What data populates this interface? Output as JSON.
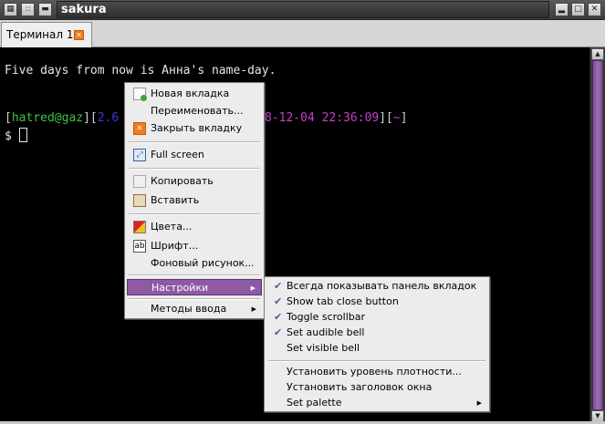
{
  "window": {
    "title": "sakura",
    "buttons": [
      "terminal-icon",
      "menu-icon",
      "minimize-icon",
      "minimize",
      "maximize",
      "close"
    ]
  },
  "tabs": [
    {
      "label": "Терминал 1",
      "close_icon": "close-x-icon"
    }
  ],
  "terminal": {
    "line1": "Five days from now is Анна's name-day.",
    "prompt": {
      "open": "[",
      "user": "hatred@gaz",
      "mid": "][",
      "version": "2.6",
      "date_tail": "8-12-04 22:36:09",
      "mid2": "][",
      "path": "~",
      "close": "]"
    },
    "ps1": "$ "
  },
  "context_menu": {
    "items": [
      {
        "label": "Новая вкладка",
        "icon": "new-tab-icon"
      },
      {
        "label": "Переименовать...",
        "icon": ""
      },
      {
        "label": "Закрыть вкладку",
        "icon": "close-tab-icon"
      },
      {
        "label": "Full screen",
        "icon": "fullscreen-icon"
      },
      {
        "label": "Копировать",
        "icon": "copy-icon"
      },
      {
        "label": "Вставить",
        "icon": "paste-icon"
      },
      {
        "label": "Цвета...",
        "icon": "colors-icon"
      },
      {
        "label": "Шрифт...",
        "icon": "font-icon"
      },
      {
        "label": "Фоновый рисунок...",
        "icon": ""
      },
      {
        "label": "Настройки",
        "submenu": true
      },
      {
        "label": "Методы ввода",
        "submenu": true
      }
    ]
  },
  "settings_submenu": {
    "items": [
      {
        "label": "Всегда показывать панель вкладок",
        "checked": true
      },
      {
        "label": "Show tab close button",
        "checked": true
      },
      {
        "label": "Toggle scrollbar",
        "checked": true
      },
      {
        "label": "Set audible bell",
        "checked": true
      },
      {
        "label": "Set visible bell",
        "checked": false
      },
      {
        "label": "Установить уровень плотности...",
        "checked": false
      },
      {
        "label": "Установить заголовок окна",
        "checked": false
      },
      {
        "label": "Set palette",
        "checked": false,
        "submenu": true
      }
    ]
  },
  "colors": {
    "accent": "#8e5aa3",
    "prompt_user": "#3ec43e",
    "prompt_version": "#3b3bd6",
    "prompt_date": "#c840c8",
    "prompt_bracket": "#d0d0d0"
  }
}
